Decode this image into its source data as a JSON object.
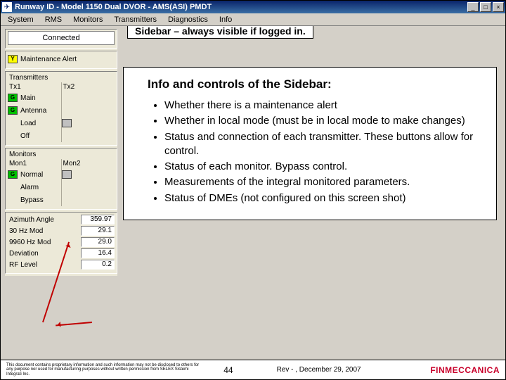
{
  "window": {
    "title": "Runway ID - Model 1150 Dual DVOR - AMS(ASI) PMDT",
    "min": "_",
    "max": "□",
    "close": "×"
  },
  "menubar": [
    "System",
    "RMS",
    "Monitors",
    "Transmitters",
    "Diagnostics",
    "Info"
  ],
  "sidebar": {
    "connected": "Connected",
    "alert": {
      "led": "Y",
      "label": "Maintenance Alert"
    },
    "tx": {
      "legend": "Transmitters",
      "col1": "Tx1",
      "col2": "Tx2",
      "main_g": "G",
      "main_label": "Main",
      "ant_g": "G",
      "ant_label": "Antenna",
      "load_label": "Load",
      "load_led": "",
      "off_label": "Off"
    },
    "mon": {
      "legend": "Monitors",
      "col1": "Mon1",
      "col2": "Mon2",
      "normal_led": "G",
      "normal_label": "Normal",
      "normal_led2": "",
      "alarm_label": "Alarm",
      "bypass_label": "Bypass"
    },
    "meas": [
      {
        "label": "Azimuth Angle",
        "val": "359.97"
      },
      {
        "label": "30 Hz Mod",
        "val": "29.1"
      },
      {
        "label": "9960 Hz Mod",
        "val": "29.0"
      },
      {
        "label": "Deviation",
        "val": "16.4"
      },
      {
        "label": "RF Level",
        "val": "0.2"
      }
    ]
  },
  "callout": "Sidebar – always visible if logged in.",
  "content": {
    "heading": "Info and controls of the Sidebar:",
    "bullets": [
      "Whether there is a maintenance alert",
      "Whether in local mode (must be in local mode to make changes)",
      "Status and connection of each transmitter.  These buttons allow for control.",
      "Status of each monitor.  Bypass control.",
      "Measurements of the integral monitored parameters.",
      "Status of DMEs (not configured on this screen shot)"
    ]
  },
  "footer": {
    "disclaimer": "This document contains proprietary information and such information may not be disclosed to others for any purpose nor used for manufacturing purposes without written permission from SELEX Sistemi Integrati Inc.",
    "page": "44",
    "rev": "Rev - , December 29, 2007",
    "brand": "FINMECCANICA"
  }
}
